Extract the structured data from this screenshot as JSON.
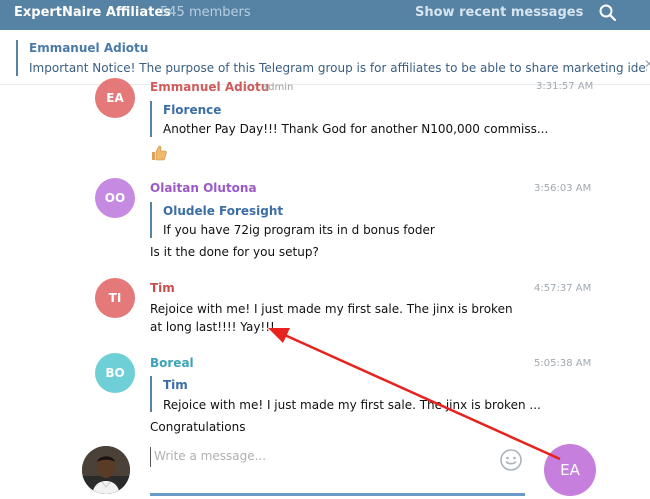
{
  "header": {
    "title": "ExpertNaire Affiliates",
    "members": "545 members",
    "recent_link": "Show recent messages",
    "search_icon": "search-icon"
  },
  "pinned": {
    "name": "Emmanuel Adiotu",
    "text": "Important Notice! The purpose of this Telegram group is for affiliates to be able to share marketing ideas a..."
  },
  "messages": [
    {
      "initials": "EA",
      "author": "Emmanuel Adiotu",
      "role": "admin",
      "time": "3:31:57 AM",
      "forward_name": "Florence",
      "forward_text": "Another Pay Day!!! Thank God for another N100,000 commiss...",
      "sticker_icon": "thumbs-up-icon"
    },
    {
      "initials": "OO",
      "author": "Olaitan Olutona",
      "time": "3:56:03 AM",
      "forward_name": "Oludele Foresight",
      "forward_text": "If you have 72ig program its in d bonus foder",
      "text": "Is it the done for you setup?"
    },
    {
      "initials": "TI",
      "author": "Tim",
      "time": "4:57:37 AM",
      "text": "Rejoice with me! I just made my first sale. The jinx is broken at long last!!!! Yay!!!"
    },
    {
      "initials": "BO",
      "author": "Boreal",
      "time": "5:05:38 AM",
      "forward_name": "Tim",
      "forward_text": "Rejoice with me! I just made my first sale. The jinx is broken ...",
      "text": "Congratulations"
    }
  ],
  "composer": {
    "placeholder": "Write a message...",
    "emoji_icon": "smiley-icon",
    "fab_initials": "EA"
  },
  "colors": {
    "header_bg": "#5682a3",
    "avatar_ea": "#e57878",
    "avatar_oo": "#c58ae2",
    "avatar_ti": "#e57878",
    "avatar_bo": "#6fcfd6",
    "author_ea": "#d05a5a",
    "author_oo": "#9b59c8",
    "author_ti": "#c94d4d",
    "author_bo": "#3aa3b5",
    "annotation_arrow": "#e8221f"
  }
}
